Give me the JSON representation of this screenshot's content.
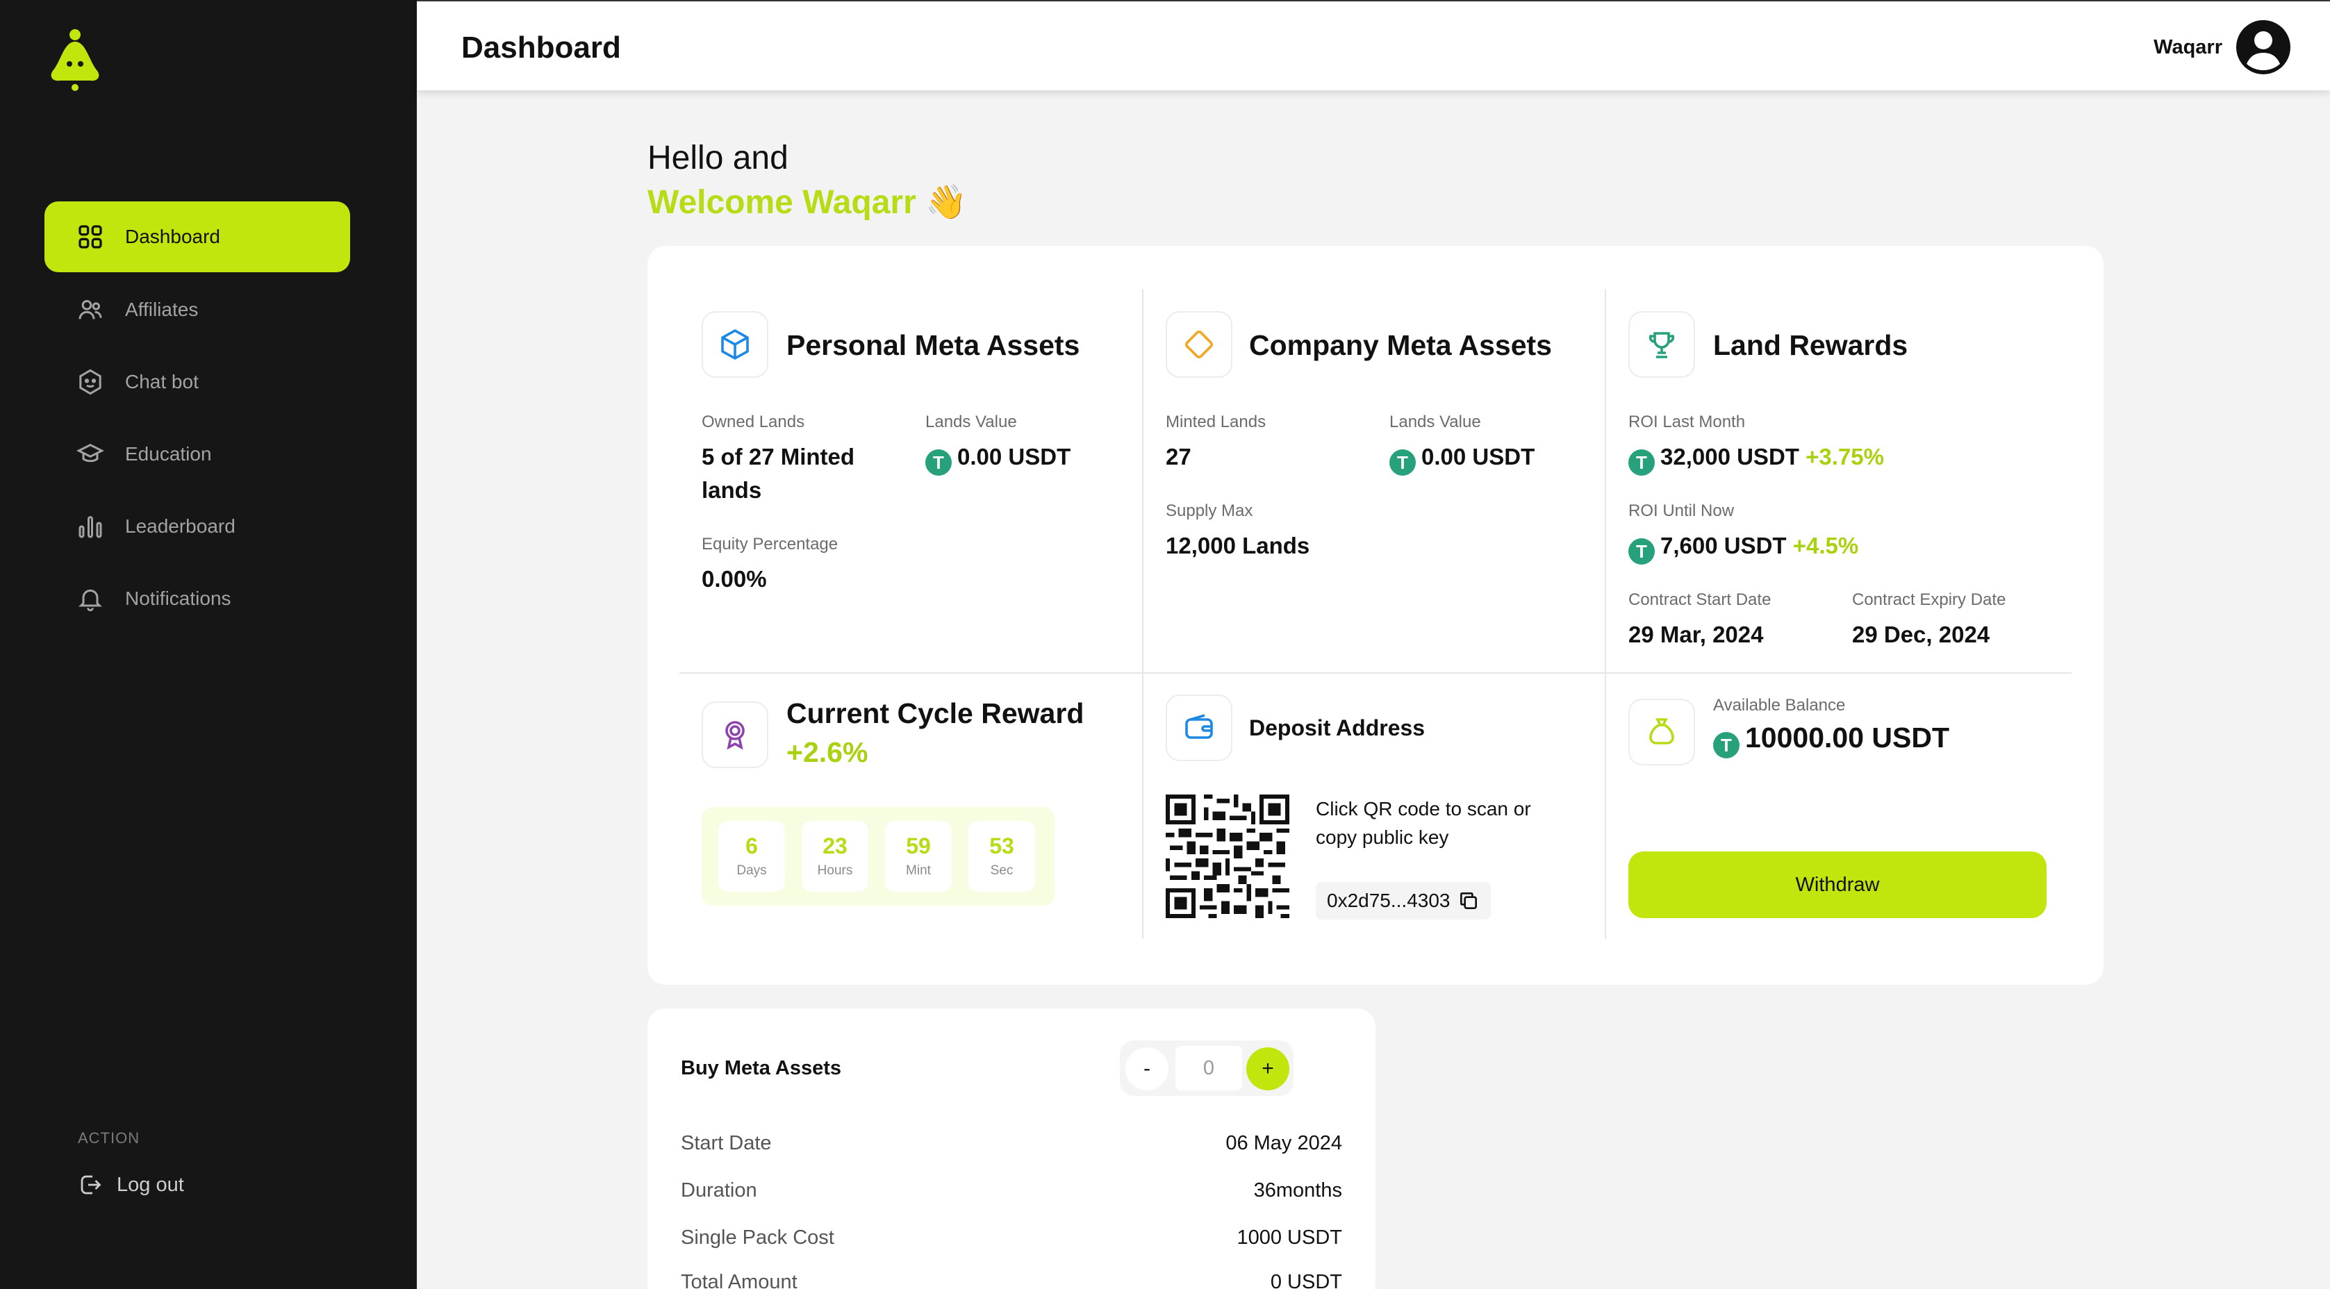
{
  "app": {
    "accent": "#c0e60d"
  },
  "sidebar": {
    "items": [
      {
        "label": "Dashboard",
        "icon": "grid-icon",
        "active": true
      },
      {
        "label": "Affiliates",
        "icon": "users-icon"
      },
      {
        "label": "Chat bot",
        "icon": "bot-face-icon"
      },
      {
        "label": "Education",
        "icon": "graduation-cap-icon"
      },
      {
        "label": "Leaderboard",
        "icon": "bar-chart-icon"
      },
      {
        "label": "Notifications",
        "icon": "bell-icon"
      }
    ],
    "section_label": "ACTION",
    "logout_label": "Log out"
  },
  "header": {
    "title": "Dashboard",
    "user_name": "Waqarr"
  },
  "greeting": {
    "line1": "Hello and",
    "line2": "Welcome Waqarr 👋"
  },
  "personal": {
    "title": "Personal Meta Assets",
    "owned_label": "Owned Lands",
    "owned_value_1": "5 of 27 Minted",
    "owned_value_2": "lands",
    "lands_value_label": "Lands Value",
    "lands_value": "0.00 USDT",
    "equity_label": "Equity Percentage",
    "equity_value": "0.00%"
  },
  "company": {
    "title": "Company Meta Assets",
    "minted_label": "Minted Lands",
    "minted_value": "27",
    "lands_value_label": "Lands Value",
    "lands_value": "0.00 USDT",
    "supply_label": "Supply Max",
    "supply_value": "12,000 Lands"
  },
  "rewards": {
    "title": "Land Rewards",
    "roi_month_label": "ROI Last Month",
    "roi_month_value": "32,000 USDT",
    "roi_month_change": "+3.75%",
    "roi_total_label": "ROI Until Now",
    "roi_total_value": "7,600 USDT",
    "roi_total_change": "+4.5%",
    "start_label": "Contract Start Date",
    "start_value": "29 Mar, 2024",
    "expiry_label": "Contract Expiry Date",
    "expiry_value": "29 Dec, 2024"
  },
  "cycle": {
    "title": "Current Cycle Reward",
    "change": "+2.6%",
    "countdown": [
      {
        "value": "6",
        "unit": "Days"
      },
      {
        "value": "23",
        "unit": "Hours"
      },
      {
        "value": "59",
        "unit": "Mint"
      },
      {
        "value": "53",
        "unit": "Sec"
      }
    ]
  },
  "deposit": {
    "title": "Deposit Address",
    "instruction": "Click QR code to scan or copy public key",
    "key": "0x2d75...4303"
  },
  "balance": {
    "label": "Available Balance",
    "value": "10000.00 USDT",
    "withdraw_label": "Withdraw"
  },
  "buy": {
    "title": "Buy Meta Assets",
    "minus": "-",
    "plus": "+",
    "quantity": "0",
    "rows": [
      {
        "label": "Start Date",
        "value": "06 May 2024"
      },
      {
        "label": "Duration",
        "value": "36months"
      },
      {
        "label": "Single Pack Cost",
        "value": "1000 USDT"
      },
      {
        "label": "Total Amount",
        "value": "0 USDT"
      }
    ]
  }
}
